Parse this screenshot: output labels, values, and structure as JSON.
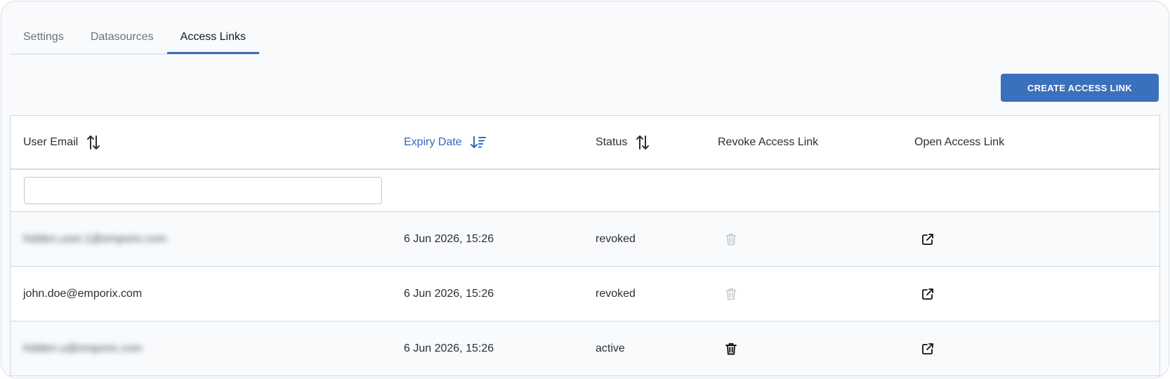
{
  "tabs": [
    {
      "label": "Settings",
      "active": false
    },
    {
      "label": "Datasources",
      "active": false
    },
    {
      "label": "Access Links",
      "active": true
    }
  ],
  "actions": {
    "create_label": "CREATE ACCESS LINK"
  },
  "table": {
    "columns": [
      {
        "label": "User Email",
        "sort": "sortable"
      },
      {
        "label": "Expiry Date",
        "sort": "descending"
      },
      {
        "label": "Status",
        "sort": "sortable"
      },
      {
        "label": "Revoke Access Link"
      },
      {
        "label": "Open Access Link"
      }
    ],
    "filter": {
      "email_value": "",
      "email_placeholder": ""
    },
    "rows": [
      {
        "email": "hidden.user.1@emporix.com",
        "email_obscured": true,
        "expiry": "6 Jun 2026, 15:26",
        "status": "revoked",
        "revoke_enabled": false
      },
      {
        "email": "john.doe@emporix.com",
        "email_obscured": false,
        "expiry": "6 Jun 2026, 15:26",
        "status": "revoked",
        "revoke_enabled": false
      },
      {
        "email": "hidden.u@emporix.com",
        "email_obscured": true,
        "expiry": "6 Jun 2026, 15:26",
        "status": "active",
        "revoke_enabled": true
      }
    ]
  },
  "colors": {
    "accent": "#3b70bc",
    "sorted_header": "#2d6bc0",
    "disabled_icon": "#c4c9cf",
    "enabled_icon": "#111111"
  },
  "icons": {
    "sort": "sort-arrows-icon",
    "sorted_desc": "sort-descending-icon",
    "revoke": "trash-icon",
    "open": "external-link-icon"
  }
}
